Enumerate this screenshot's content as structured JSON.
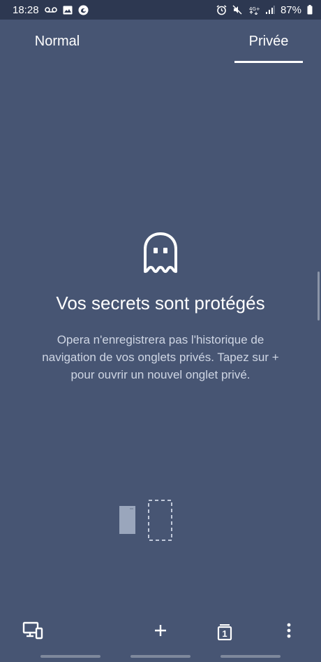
{
  "status_bar": {
    "time": "18:28",
    "battery": "87%",
    "network": "4G+",
    "left_icons": [
      "voicemail-icon",
      "image-icon",
      "firefox-icon"
    ],
    "right_icons": [
      "alarm-icon",
      "mute-icon",
      "network-4g-icon",
      "signal-icon",
      "battery-icon"
    ]
  },
  "tabs": {
    "normal_label": "Normal",
    "private_label": "Privée",
    "selected": "private"
  },
  "empty_state": {
    "icon": "ghost-icon",
    "headline": "Vos secrets sont protégés",
    "body": "Opera n'enregistrera pas l'historique de navigation de vos onglets privés. Tapez sur + pour ouvrir un nouvel onglet privé."
  },
  "bottom_bar": {
    "buttons": [
      "devices-icon",
      "add-tab-icon",
      "tab-count-icon",
      "more-menu-icon"
    ],
    "tab_count": "1"
  },
  "colors": {
    "background": "#475573",
    "status_bar": "#2d3851",
    "accent": "#ffffff",
    "secondary_text": "#cfd6e4"
  }
}
